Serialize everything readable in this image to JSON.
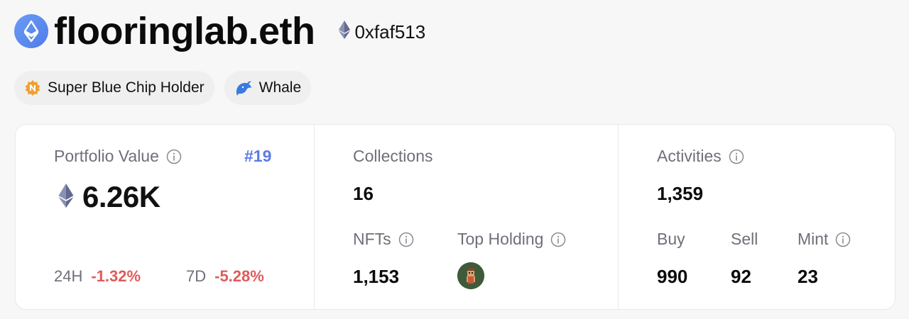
{
  "header": {
    "title": "flooringlab.eth",
    "address": "0xfaf513",
    "logo_icon": "ens-logo-icon",
    "address_icon": "ethereum-icon"
  },
  "badges": [
    {
      "label": "Super Blue Chip Holder",
      "icon": "blue-chip-badge-icon",
      "color": "#f0a030"
    },
    {
      "label": "Whale",
      "icon": "whale-icon",
      "color": "#3a7be0"
    }
  ],
  "portfolio": {
    "label": "Portfolio Value",
    "rank": "#19",
    "value": "6.26K",
    "change_24h_label": "24H",
    "change_24h": "-1.32%",
    "change_7d_label": "7D",
    "change_7d": "-5.28%"
  },
  "collections": {
    "label": "Collections",
    "value": "16",
    "nfts_label": "NFTs",
    "nfts_value": "1,153",
    "top_holding_label": "Top Holding"
  },
  "activities": {
    "label": "Activities",
    "value": "1,359",
    "buy_label": "Buy",
    "buy_value": "990",
    "sell_label": "Sell",
    "sell_value": "92",
    "mint_label": "Mint",
    "mint_value": "23"
  },
  "colors": {
    "accent": "#5b7ae8",
    "negative": "#e05a5a",
    "muted": "#6f6f78"
  }
}
